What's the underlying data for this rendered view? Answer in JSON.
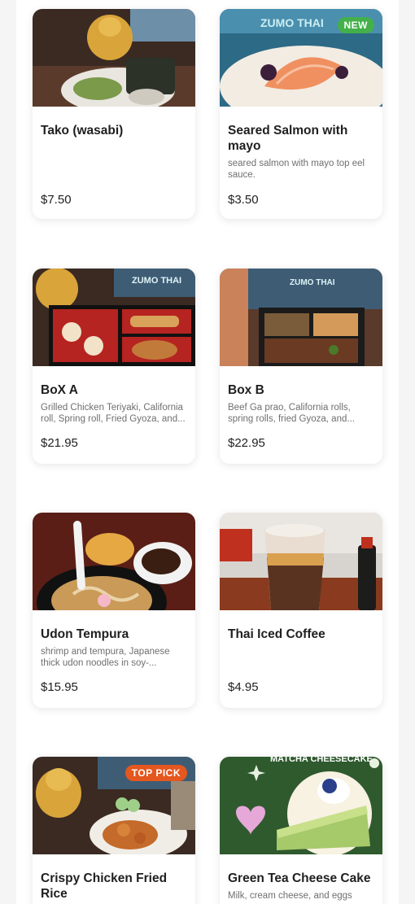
{
  "menu_items": [
    {
      "name": "Tako (wasabi)",
      "description": "",
      "price": "$7.50",
      "badge": "",
      "image_text": ""
    },
    {
      "name": "Seared Salmon with mayo",
      "description": "seared salmon with mayo top eel sauce.",
      "price": "$3.50",
      "badge": "NEW",
      "image_text": "ZUMO THAI"
    },
    {
      "name": "BoX A",
      "description": "Grilled Chicken Teriyaki, California roll, Spring roll, Fried Gyoza, and...",
      "price": "$21.95",
      "badge": "",
      "image_text": "ZUMO THAI"
    },
    {
      "name": "Box B",
      "description": "Beef Ga prao, California rolls, spring rolls, fried Gyoza, and...",
      "price": "$22.95",
      "badge": "",
      "image_text": "ZUMO THAI"
    },
    {
      "name": "Udon Tempura",
      "description": "shrimp and tempura, Japanese thick udon noodles in soy-...",
      "price": "$15.95",
      "badge": "",
      "image_text": ""
    },
    {
      "name": "Thai Iced Coffee",
      "description": "",
      "price": "$4.95",
      "badge": "",
      "image_text": ""
    },
    {
      "name": "Crispy Chicken Fried Rice",
      "description": "",
      "price": "",
      "badge": "TOP PICK",
      "image_text": ""
    },
    {
      "name": "Green Tea Cheese Cake",
      "description": "Milk, cream cheese, and eggs",
      "price": "",
      "badge": "",
      "image_text": "MATCHA CHEESECAKE"
    }
  ],
  "colors": {
    "new_badge": "#43b04a",
    "top_pick_badge": "#e4571f"
  }
}
